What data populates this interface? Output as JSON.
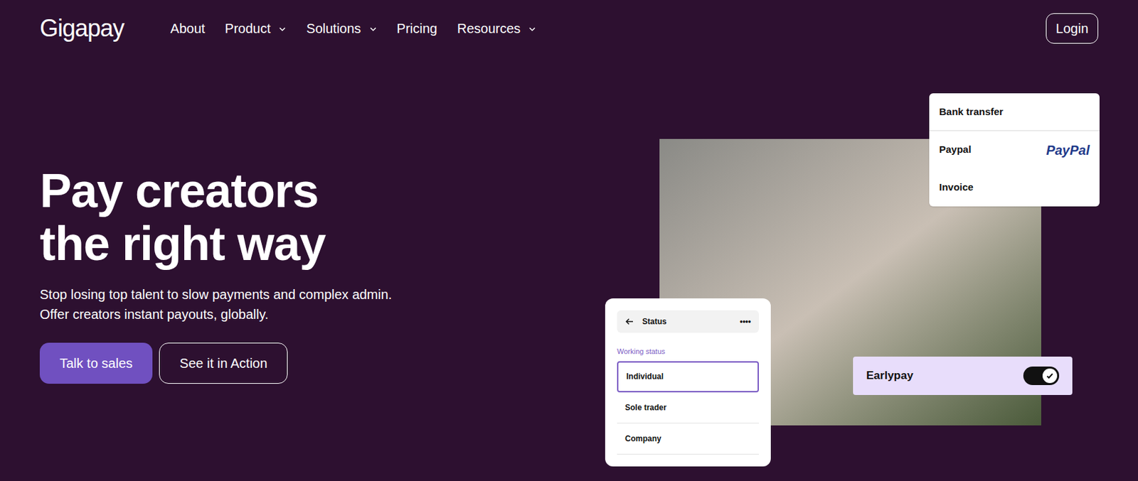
{
  "logo": "Gigapay",
  "nav": {
    "items": [
      {
        "label": "About",
        "dropdown": false
      },
      {
        "label": "Product",
        "dropdown": true
      },
      {
        "label": "Solutions",
        "dropdown": true
      },
      {
        "label": "Pricing",
        "dropdown": false
      },
      {
        "label": "Resources",
        "dropdown": true
      }
    ],
    "login": "Login"
  },
  "hero": {
    "title_lines": [
      "Pay creators",
      "the right way"
    ],
    "subtitle_lines": [
      "Stop losing top talent to slow payments and complex admin.",
      "Offer creators instant payouts, globally."
    ],
    "buttons": [
      {
        "label": "Talk to sales",
        "kind": "primary"
      },
      {
        "label": "See it in Action",
        "kind": "outline"
      }
    ]
  },
  "payment_card": {
    "options": [
      {
        "label": "Bank transfer",
        "logo": ""
      },
      {
        "label": "Paypal",
        "logo": "PayPal"
      },
      {
        "label": "Invoice",
        "logo": ""
      }
    ]
  },
  "status_card": {
    "title": "Status",
    "menu": "••••",
    "label": "Working status",
    "options": [
      {
        "label": "Individual",
        "selected": true
      },
      {
        "label": "Sole trader",
        "selected": false
      },
      {
        "label": "Company",
        "selected": false
      }
    ]
  },
  "earlypay": {
    "label": "Earlypay",
    "on": true
  }
}
